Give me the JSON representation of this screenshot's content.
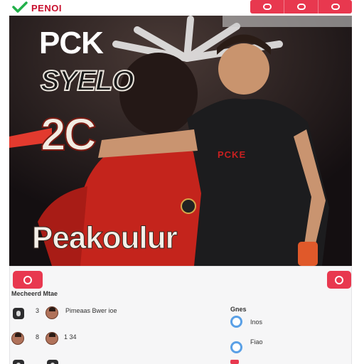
{
  "app": {
    "brand": "PENOI",
    "accent_color": "#e8384f",
    "check_icon": "check-icon",
    "top_actions": [
      {
        "icon": "pill-icon"
      },
      {
        "icon": "pill-icon"
      },
      {
        "icon": "pill-icon"
      }
    ]
  },
  "hero": {
    "line1": "PCK",
    "line2": "SYELO",
    "line3": "2C",
    "line4": "Peakoulur"
  },
  "panel": {
    "left_button_icon": "record-icon",
    "right_button_icon": "record-icon",
    "section_label": "Mecheerd Mtae",
    "rows": [
      {
        "icon": "phone-icon",
        "number": "3",
        "text": "Pimeaas Bwer ioe"
      },
      {
        "icon": "avatar-icon",
        "number": "8",
        "text": "1 34"
      }
    ],
    "side_title": "Gnes",
    "side_items": [
      {
        "icon": "circle-icon",
        "text": "Inos"
      },
      {
        "icon": "circle-icon",
        "text": "Fiao"
      }
    ]
  }
}
